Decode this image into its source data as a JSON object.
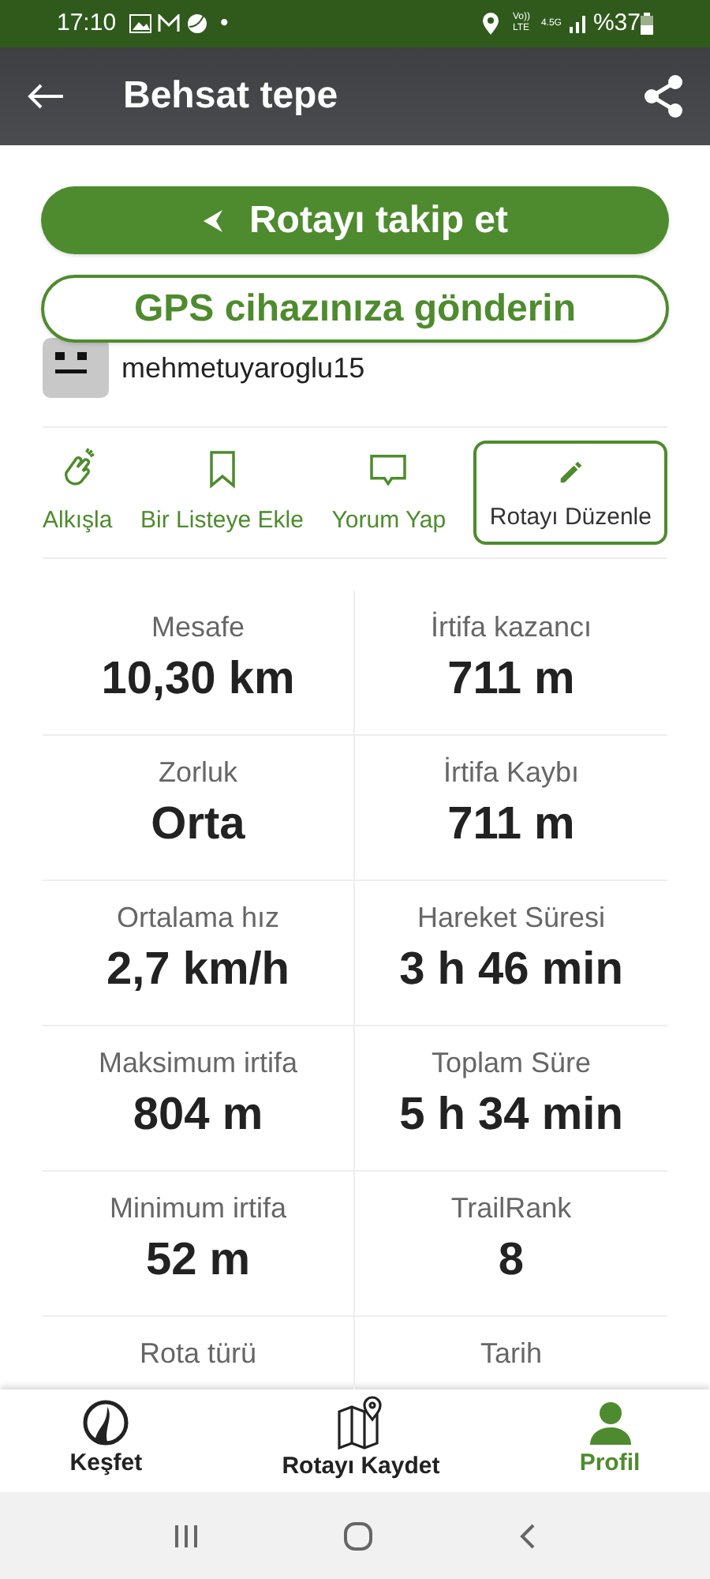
{
  "status_bar": {
    "time": "17:10",
    "dot": "•",
    "network": "Vo)) LTE",
    "signal_type": "4.5G",
    "battery": "%37"
  },
  "app_bar": {
    "title": "Behsat tepe"
  },
  "buttons": [
    {
      "kind": "filled",
      "label": "Rotayı takip et"
    },
    {
      "kind": "outline",
      "label": "GPS cihazınıza gönderin"
    }
  ],
  "author": {
    "name": "mehmetuyaroglu15"
  },
  "actions": [
    {
      "kind": "clap",
      "label": "Alkışla",
      "selected": false
    },
    {
      "kind": "bookmark",
      "label": "Bir Listeye Ekle",
      "selected": false
    },
    {
      "kind": "comment",
      "label": "Yorum Yap",
      "selected": false
    },
    {
      "kind": "edit",
      "label": "Rotayı Düzenle",
      "selected": true
    }
  ],
  "stats": [
    [
      {
        "label": "Mesafe",
        "value": "10,30 km"
      },
      {
        "label": "İrtifa kazancı",
        "value": "711 m"
      }
    ],
    [
      {
        "label": "Zorluk",
        "value": "Orta"
      },
      {
        "label": "İrtifa Kaybı",
        "value": "711 m"
      }
    ],
    [
      {
        "label": "Ortalama hız",
        "value": "2,7 km/h"
      },
      {
        "label": "Hareket Süresi",
        "value": "3 h 46 min"
      }
    ],
    [
      {
        "label": "Maksimum irtifa",
        "value": "804 m"
      },
      {
        "label": "Toplam Süre",
        "value": "5 h 34 min"
      }
    ],
    [
      {
        "label": "Minimum irtifa",
        "value": "52 m"
      },
      {
        "label": "TrailRank",
        "value": "8"
      }
    ],
    [
      {
        "label": "Rota türü"
      },
      {
        "label": "Tarih"
      }
    ]
  ],
  "bottom_nav": [
    {
      "kind": "explore",
      "label": "Keşfet",
      "selected": false
    },
    {
      "kind": "record",
      "label": "Rotayı Kaydet",
      "selected": false
    },
    {
      "kind": "profile",
      "label": "Profil",
      "selected": true
    }
  ]
}
